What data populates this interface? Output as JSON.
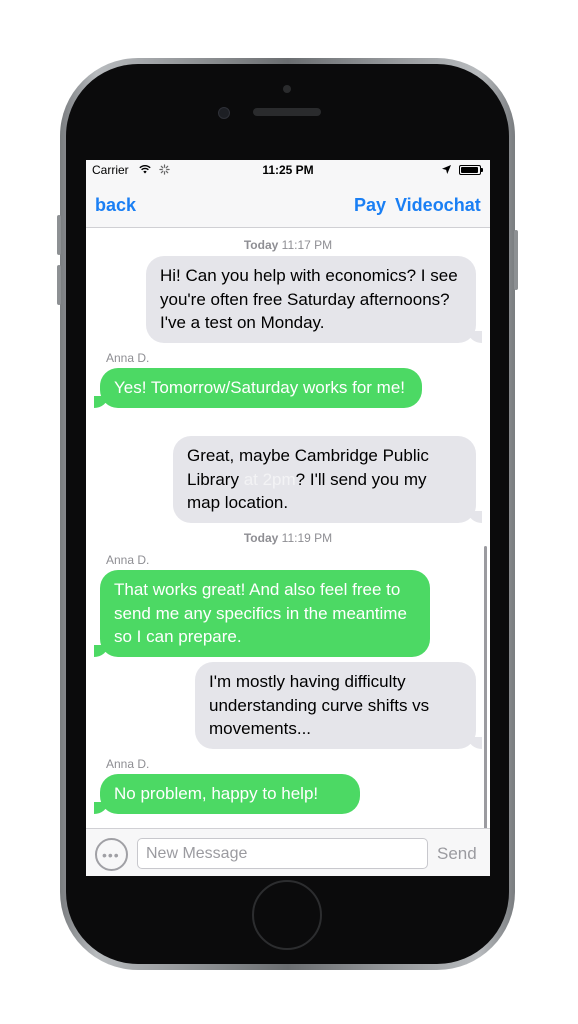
{
  "status_bar": {
    "carrier": "Carrier",
    "time": "11:25 PM"
  },
  "nav": {
    "back": "back",
    "pay": "Pay",
    "videochat": "Videochat"
  },
  "messages": [
    {
      "type": "timestamp",
      "day": "Today",
      "time": "11:17 PM"
    },
    {
      "type": "outgoing",
      "text": "Hi! Can you help with economics? I see you're often free Saturday afternoons? I've a test on Monday."
    },
    {
      "type": "incoming",
      "sender": "Anna D.",
      "text": "Yes! Tomorrow/Saturday works for me!"
    },
    {
      "type": "outgoing",
      "text_before": "Great, maybe Cambridge Public Library ",
      "highlight": "at 2pm",
      "text_after": "? I'll send you my map location."
    },
    {
      "type": "timestamp",
      "day": "Today",
      "time": "11:19 PM"
    },
    {
      "type": "incoming",
      "sender": "Anna D.",
      "text": "That works great! And also feel free to send me any specifics in the meantime so I can prepare."
    },
    {
      "type": "outgoing",
      "text": "I'm mostly having difficulty understanding curve shifts vs movements..."
    },
    {
      "type": "incoming",
      "sender": "Anna D.",
      "text": "No problem, happy to help!"
    }
  ],
  "input": {
    "placeholder": "New Message",
    "value": "",
    "send": "Send"
  },
  "colors": {
    "accent": "#1a7ff4",
    "incoming_bubble": "#4cd964",
    "outgoing_bubble": "#e5e5ea"
  },
  "icons": [
    "wifi-icon",
    "activity-spinner-icon",
    "location-arrow-icon",
    "battery-icon",
    "more-options-icon"
  ]
}
